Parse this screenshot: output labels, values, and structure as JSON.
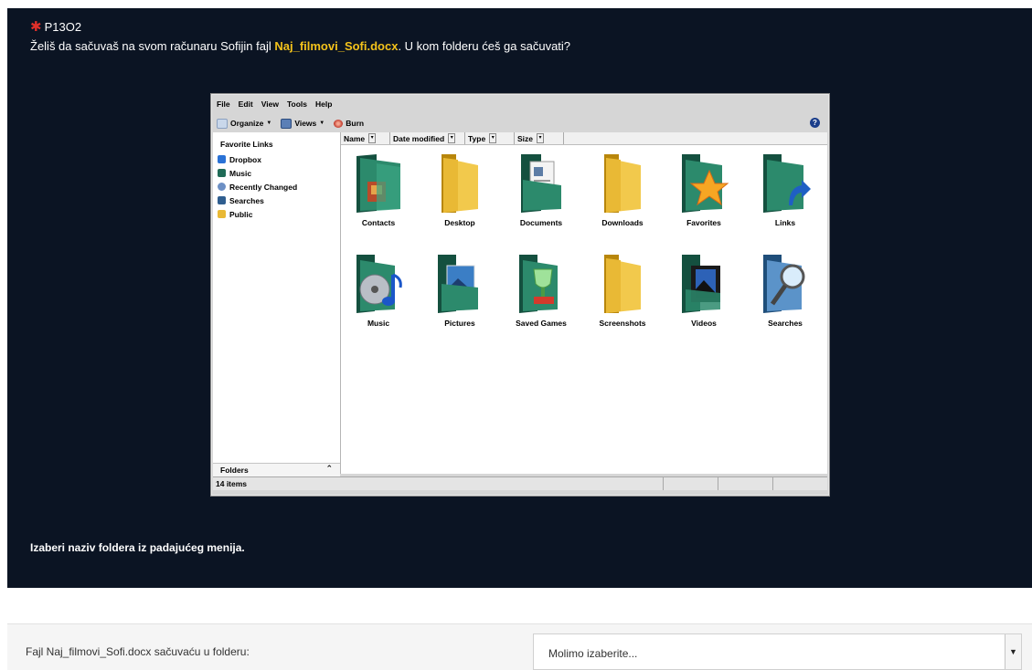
{
  "question": {
    "code": "P13O2",
    "text_before": "Želiš da sačuvaš na svom računaru Sofijin fajl ",
    "file_name": "Naj_filmovi_Sofi.docx",
    "text_after": ". U kom folderu ćeš ga sačuvati?",
    "instruction": "Izaberi naziv foldera iz padajućeg menija."
  },
  "explorer": {
    "menu": [
      "File",
      "Edit",
      "View",
      "Tools",
      "Help"
    ],
    "toolbar": {
      "organize": "Organize",
      "views": "Views",
      "burn": "Burn"
    },
    "nav": {
      "title": "Favorite Links",
      "items": [
        "Dropbox",
        "Music",
        "Recently Changed",
        "Searches",
        "Public"
      ],
      "folders_label": "Folders"
    },
    "columns": [
      "Name",
      "Date modified",
      "Type",
      "Size"
    ],
    "folders": [
      "Contacts",
      "Desktop",
      "Documents",
      "Downloads",
      "Favorites",
      "Links",
      "Music",
      "Pictures",
      "Saved Games",
      "Screenshots",
      "Videos",
      "Searches"
    ],
    "status": "14 items"
  },
  "answer": {
    "label": "Fajl Naj_filmovi_Sofi.docx sačuvaću u folderu:",
    "select_value": "Molimo izaberite..."
  },
  "colors": {
    "panel_bg": "#0b1423",
    "highlight": "#f3c21b",
    "folder_green": "#1f6b57",
    "folder_yellow": "#e9b935"
  }
}
